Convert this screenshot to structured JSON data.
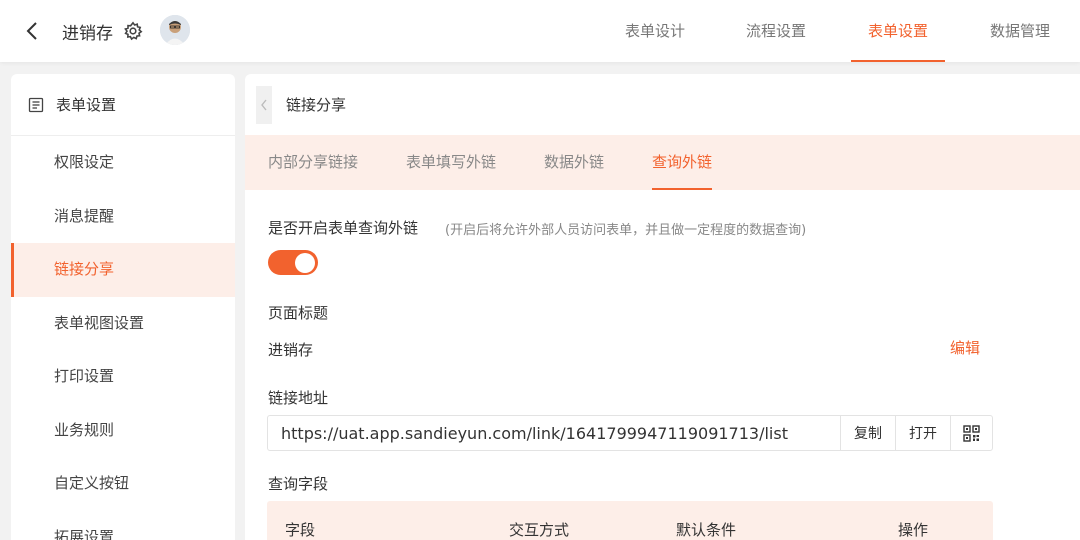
{
  "header": {
    "back_icon": "chevron-left-icon",
    "title": "进销存",
    "settings_icon": "gear-icon",
    "avatar_icon": "avatar-icon",
    "tabs": [
      {
        "label": "表单设计"
      },
      {
        "label": "流程设置"
      },
      {
        "label": "表单设置"
      },
      {
        "label": "数据管理"
      }
    ],
    "active_tab": "表单设置"
  },
  "sidebar": {
    "header_icon": "list-icon",
    "header_label": "表单设置",
    "items": [
      {
        "label": "权限设定"
      },
      {
        "label": "消息提醒"
      },
      {
        "label": "链接分享"
      },
      {
        "label": "表单视图设置"
      },
      {
        "label": "打印设置"
      },
      {
        "label": "业务规则"
      },
      {
        "label": "自定义按钮"
      },
      {
        "label": "拓展设置"
      }
    ],
    "active_item": "链接分享"
  },
  "main": {
    "title": "链接分享",
    "subtabs": [
      {
        "label": "内部分享链接"
      },
      {
        "label": "表单填写外链"
      },
      {
        "label": "数据外链"
      },
      {
        "label": "查询外链"
      }
    ],
    "active_subtab": "查询外链",
    "enable_label": "是否开启表单查询外链",
    "enable_hint": "(开启后将允许外部人员访问表单，并且做一定程度的数据查询)",
    "enable_on": true,
    "page_title_label": "页面标题",
    "page_title_value": "进销存",
    "edit_label": "编辑",
    "link_label": "链接地址",
    "link_value": "https://uat.app.sandieyun.com/link/1641799947119091713/list",
    "copy_label": "复制",
    "open_label": "打开",
    "qr_icon": "qrcode-icon",
    "query_fields_label": "查询字段",
    "table_headers": [
      "字段",
      "交互方式",
      "默认条件",
      "操作"
    ]
  },
  "colors": {
    "accent": "#f2622e",
    "accent_light": "#fdeee8",
    "background": "#f2f2f2"
  }
}
